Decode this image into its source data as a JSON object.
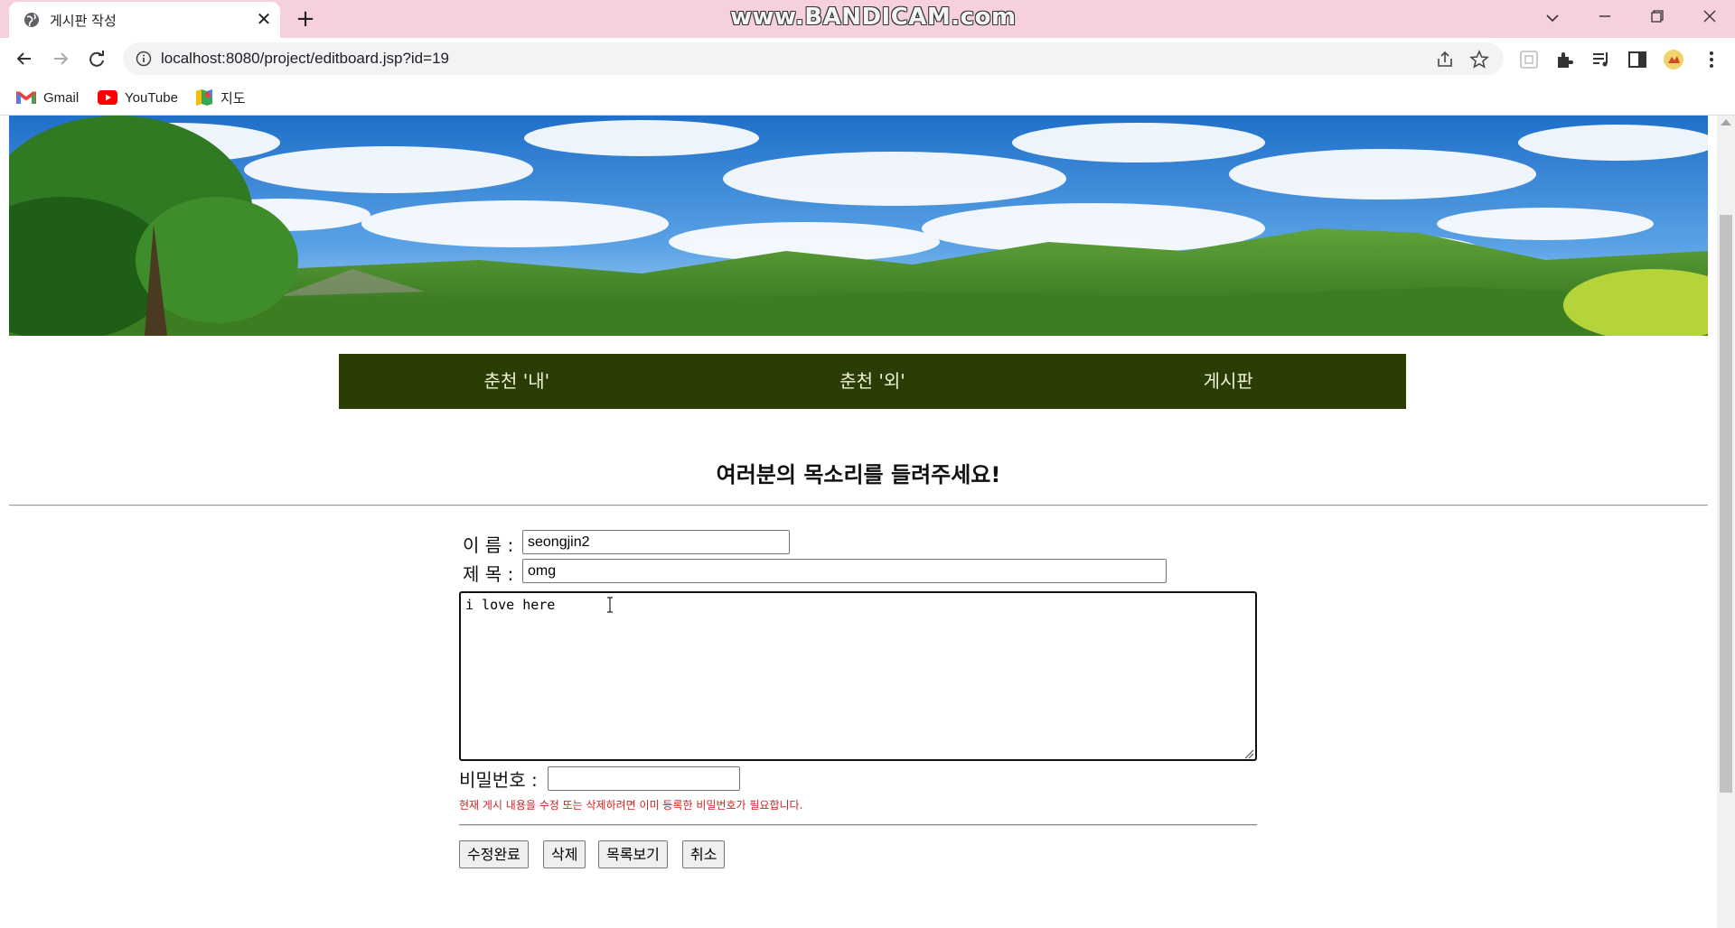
{
  "browser": {
    "tab_title": "게시판 작성",
    "tab_close": "✕",
    "new_tab": "+",
    "watermark": "www.BANDICAM.com",
    "url": "localhost:8080/project/editboard.jsp?id=19",
    "bookmarks": [
      {
        "label": "Gmail",
        "icon": "gmail-icon"
      },
      {
        "label": "YouTube",
        "icon": "youtube-icon"
      },
      {
        "label": "지도",
        "icon": "maps-icon"
      }
    ]
  },
  "page": {
    "menu": [
      "춘천 '내'",
      "춘천 '외'",
      "게시판"
    ],
    "heading": "여러분의 목소리를 들려주세요!",
    "form": {
      "name_label": "이 름 :",
      "name_value": "seongjin2",
      "title_label": "제 목 :",
      "title_value": "omg",
      "content_value": "i love here",
      "password_label": "비밀번호 :",
      "password_value": "",
      "hint": "현재 게시 내용을 수정 또는 삭제하려면 이미 등록한 비밀번호가 필요합니다."
    },
    "buttons": {
      "submit": "수정완료",
      "delete": "삭제",
      "list": "목록보기",
      "cancel": "취소"
    }
  },
  "colors": {
    "titlebar": "#f7d0dd",
    "menu_bg": "#2a3d05",
    "menu_text": "#f0f0d8",
    "hint_text": "#cc2222"
  }
}
